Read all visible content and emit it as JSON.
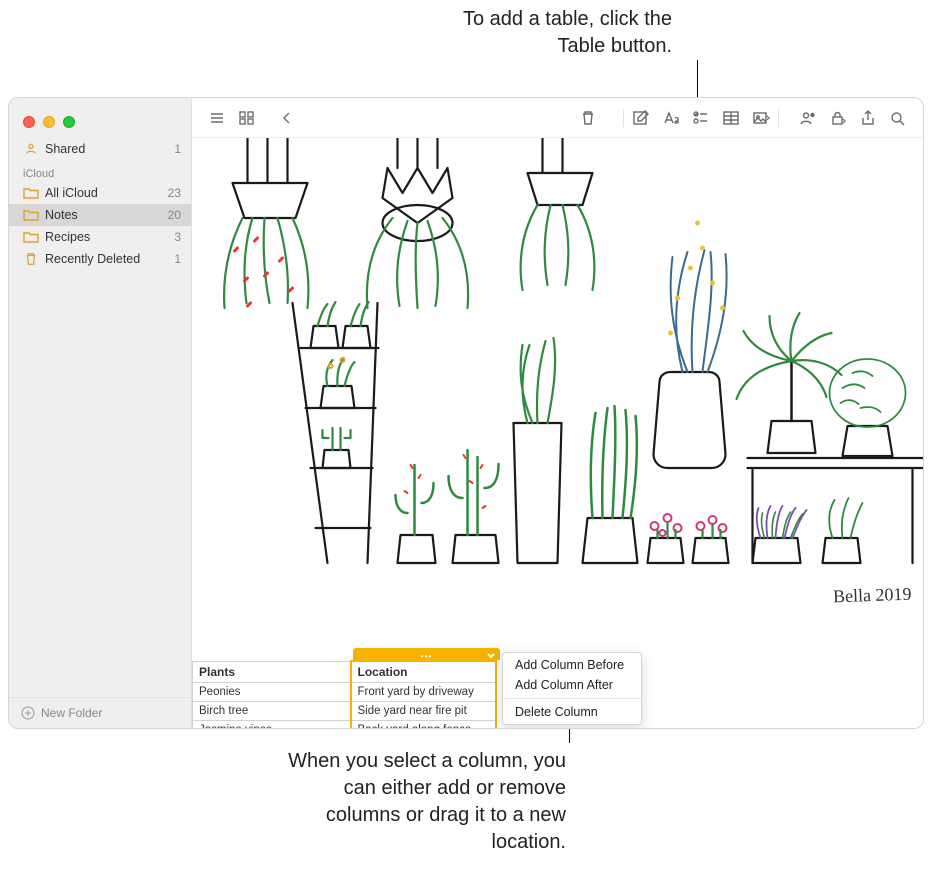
{
  "callout_top": "To add a table, click the Table button.",
  "callout_bottom": "When you select a column, you can either add or remove columns or drag it to a new location.",
  "sidebar": {
    "shared": {
      "label": "Shared",
      "count": "1"
    },
    "section": "iCloud",
    "items": [
      {
        "label": "All iCloud",
        "count": "23"
      },
      {
        "label": "Notes",
        "count": "20"
      },
      {
        "label": "Recipes",
        "count": "3"
      },
      {
        "label": "Recently Deleted",
        "count": "1"
      }
    ],
    "footer": "New Folder"
  },
  "table": {
    "headers": [
      "Plants",
      "Location"
    ],
    "rows": [
      [
        "Peonies",
        "Front yard by driveway"
      ],
      [
        "Birch tree",
        "Side yard near fire pit"
      ],
      [
        "Jasmine vines",
        "Back yard along fence"
      ]
    ]
  },
  "context_menu": {
    "items": [
      "Add Column Before",
      "Add Column After",
      "Delete Column"
    ]
  },
  "signature": "Bella 2019"
}
